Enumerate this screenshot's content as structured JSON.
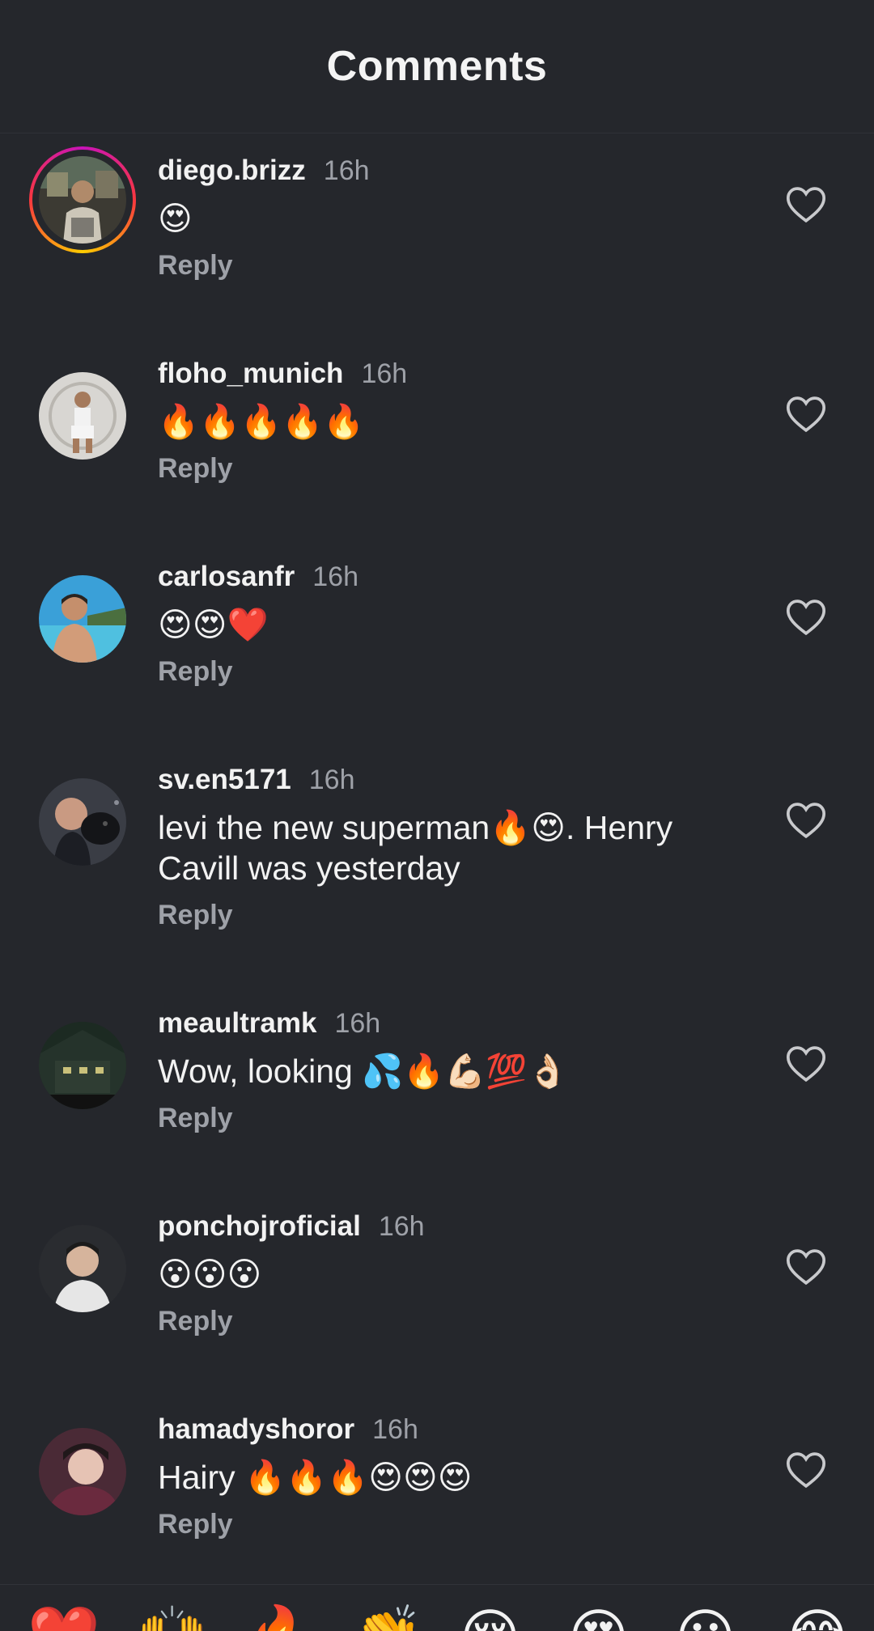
{
  "header": {
    "title": "Comments"
  },
  "comments": [
    {
      "username": "diego.brizz",
      "time": "16h",
      "text": "😍",
      "reply": "Reply"
    },
    {
      "username": "floho_munich",
      "time": "16h",
      "text": "🔥🔥🔥🔥🔥",
      "reply": "Reply"
    },
    {
      "username": "carlosanfr",
      "time": "16h",
      "text": "😍😍❤️",
      "reply": "Reply"
    },
    {
      "username": "sv.en5171",
      "time": "16h",
      "text": "levi the new superman🔥😍. Henry Cavill was yesterday",
      "reply": "Reply"
    },
    {
      "username": "meaultramk",
      "time": "16h",
      "text": "Wow, looking 💦🔥💪🏻💯👌🏻",
      "reply": "Reply"
    },
    {
      "username": "ponchojroficial",
      "time": "16h",
      "text": "😮😮😮",
      "reply": "Reply"
    },
    {
      "username": "hamadyshoror",
      "time": "16h",
      "text": "Hairy 🔥🔥🔥😍😍😍",
      "reply": "Reply"
    }
  ],
  "quick_reactions": [
    "❤️",
    "🙌",
    "🔥",
    "👏",
    "😢",
    "😍",
    "😮",
    "😂"
  ],
  "icons": {
    "like": "heart-outline-icon",
    "story_ring": "story-ring"
  },
  "colors": {
    "background": "#25272c",
    "username": "#f2f2f2",
    "secondary_text": "#9ea1a8",
    "heart_outline": "#c8c9cc"
  }
}
